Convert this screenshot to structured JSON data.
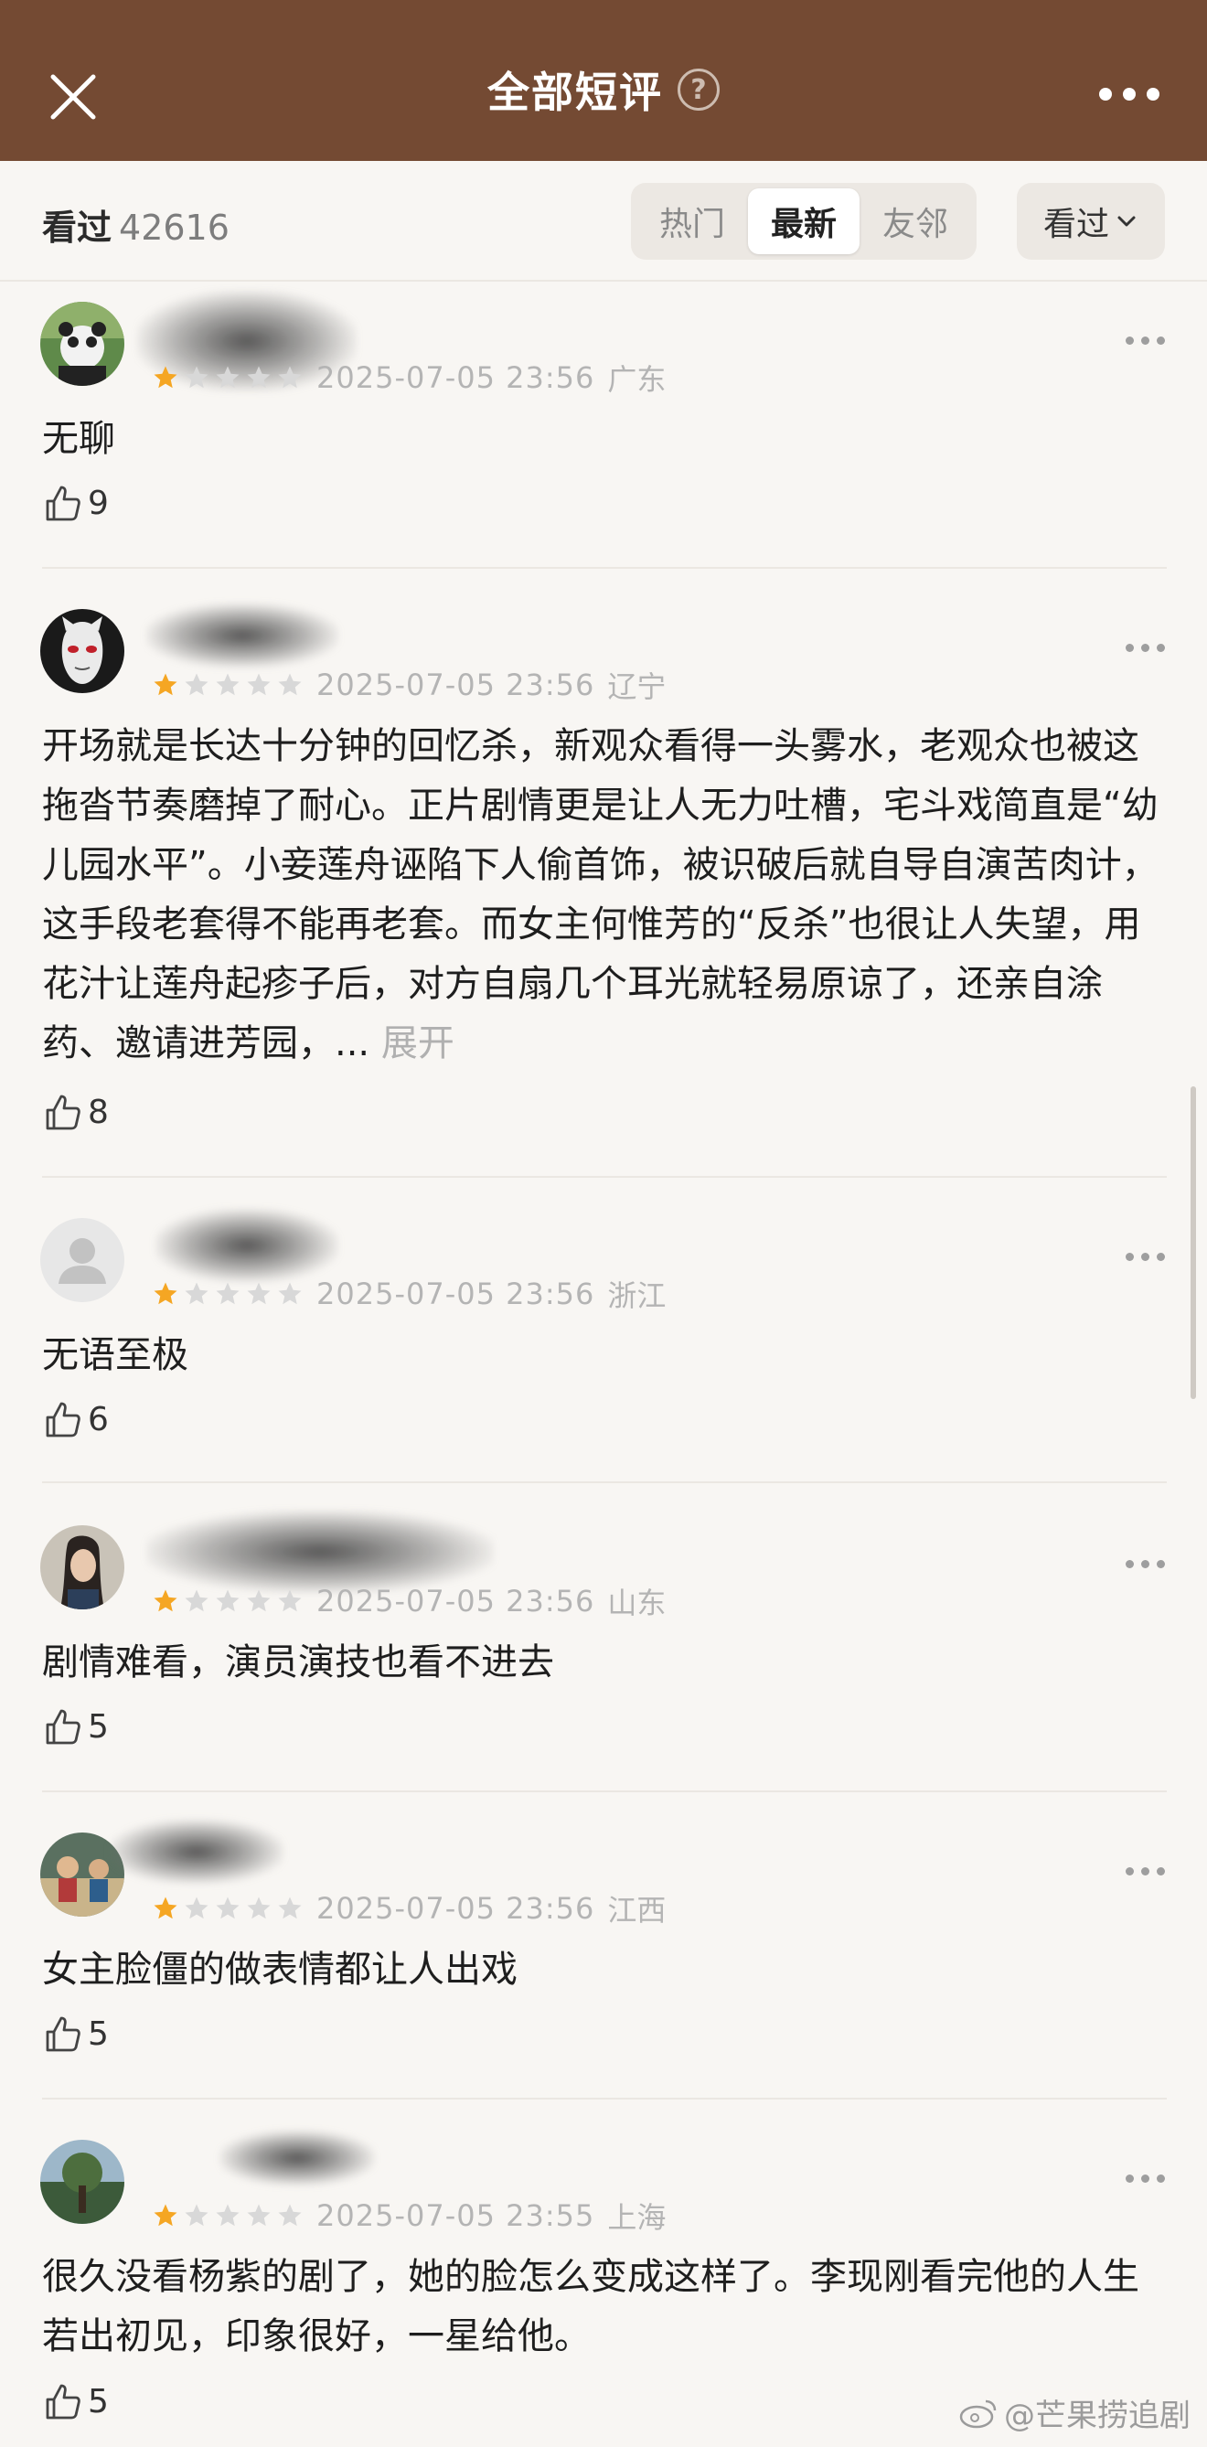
{
  "header": {
    "title": "全部短评",
    "help_icon": "question-circle-icon"
  },
  "filter": {
    "watched_label": "看过",
    "watched_count": "42616",
    "tabs": [
      {
        "label": "热门"
      },
      {
        "label": "最新"
      },
      {
        "label": "友邻"
      }
    ],
    "active_tab": "最新",
    "dropdown_label": "看过"
  },
  "colors": {
    "header_bg": "#744a33",
    "star": "#f5a623",
    "star_empty": "#d8d8d8",
    "background": "#f8f6f3"
  },
  "reviews": [
    {
      "rating": 1,
      "time": "2025-07-05 23:56",
      "location": "广东",
      "content": "无聊",
      "likes": "9",
      "name_partial": ""
    },
    {
      "rating": 1,
      "time": "2025-07-05 23:56",
      "location": "辽宁",
      "content": "开场就是长达十分钟的回忆杀，新观众看得一头雾水，老观众也被这拖沓节奏磨掉了耐心。正片剧情更是让人无力吐槽，宅斗戏简直是“幼儿园水平”。小妾莲舟诬陷下人偷首饰，被识破后就自导自演苦肉计，这手段老套得不能再老套。而女主何惟芳的“反杀”也很让人失望，用花汁让莲舟起疹子后，对方自扇几个耳光就轻易原谅了，还亲自涂药、邀请进芳园，...",
      "expand": "展开",
      "likes": "8"
    },
    {
      "rating": 1,
      "time": "2025-07-05 23:56",
      "location": "浙江",
      "content": "无语至极",
      "likes": "6"
    },
    {
      "rating": 1,
      "time": "2025-07-05 23:56",
      "location": "山东",
      "content": "剧情难看，演员演技也看不进去",
      "likes": "5",
      "name_partial": "EA4"
    },
    {
      "rating": 1,
      "time": "2025-07-05 23:56",
      "location": "江西",
      "content": "女主脸僵的做表情都让人出戏",
      "likes": "5"
    },
    {
      "rating": 1,
      "time": "2025-07-05 23:55",
      "location": "上海",
      "content": "很久没看杨紫的剧了，她的脸怎么变成这样了。李现刚看完他的人生若出初见，印象很好，一星给他。",
      "likes": "5"
    }
  ],
  "watermark": "@芒果捞追剧"
}
